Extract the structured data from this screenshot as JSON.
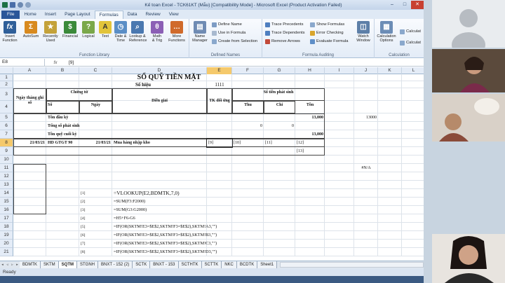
{
  "app": {
    "title": "Kế toan Excel - TCK61KT (Mẫu)  [Compatibility Mode]  -  Microsoft Excel (Product Activation Failed)",
    "win_min": "–",
    "win_max": "□",
    "win_close": "✕"
  },
  "tabs": [
    "File",
    "Home",
    "Insert",
    "Page Layout",
    "Formulas",
    "Data",
    "Review",
    "View"
  ],
  "ribbon": {
    "insert_function": "Insert\nFunction",
    "autosum": "AutoSum",
    "recently_used": "Recently\nUsed",
    "financial": "Financial",
    "logical": "Logical",
    "text": "Text",
    "date_time": "Date &\nTime",
    "lookup_reference": "Lookup &\nReference",
    "math_trig": "Math\n& Trig",
    "more_functions": "More\nFunctions",
    "group_function_library": "Function Library",
    "name_manager": "Name\nManager",
    "define_name": "Define Name",
    "use_in_formula": "Use in Formula",
    "create_from_selection": "Create from Selection",
    "group_defined_names": "Defined Names",
    "trace_precedents": "Trace Precedents",
    "trace_dependents": "Trace Dependents",
    "remove_arrows": "Remove Arrows",
    "show_formulas": "Show Formulas",
    "error_checking": "Error Checking",
    "evaluate_formula": "Evaluate Formula",
    "watch_window": "Watch\nWindow",
    "group_formula_auditing": "Formula Auditing",
    "calculation_options": "Calculation\nOptions",
    "calculate_now": "Calculat",
    "calculate_sheet": "Calculat",
    "group_calculation": "Calculation"
  },
  "formula_bar": {
    "name_box": "E8",
    "fx": "fx",
    "content": "[9]"
  },
  "columns": [
    "A",
    "B",
    "C",
    "D",
    "E",
    "F",
    "G",
    "H",
    "I",
    "J",
    "K",
    "L"
  ],
  "rows": [
    "1",
    "2",
    "3",
    "4",
    "5",
    "6",
    "7",
    "8",
    "9",
    "10",
    "11",
    "12",
    "13",
    "14",
    "15",
    "16",
    "17",
    "18",
    "19",
    "20",
    "21"
  ],
  "sheet": {
    "title": "SỔ QUỸ TIỀN MẶT",
    "so_hieu": "Số hiệu",
    "so_hieu_val": "1111",
    "ngay_thang_ghi_so": "Ngày tháng ghi sổ",
    "chung_tu": "Chứng từ",
    "so": "Số",
    "ngay": "Ngày",
    "dien_giai": "Diễn giải",
    "tk_doi_ung": "TK đối ứng",
    "so_tien_phat_sinh": "Số tiền phát sinh",
    "thu": "Thu",
    "chi": "Chi",
    "ton": "Tồn",
    "ton_dau_ky": "Tồn đầu kỳ",
    "ton_dau_ky_val": "13,000",
    "j5_val": "13000",
    "tong_so_phat_sinh": "Tổng số phát sinh",
    "f6_val": "0",
    "g6_val": "0",
    "ton_quy_cuoi_ky": "Tồn quỹ cuối kỳ",
    "h7_val": "13,000",
    "a8": "21/03/21",
    "b8": "HD GTGT 90",
    "c8": "21/03/21",
    "d8": "Mua hàng nhập kho",
    "e8": "[9]",
    "f8": "[10]",
    "g8": "[11]",
    "h8": "[12]",
    "h9": "[13]",
    "j11": "#N/A",
    "c14": "[1]",
    "d14": "=VLOOKUP(E2,BDMTK,7,0)",
    "c15": "[2]",
    "d15": "=SUM(F3:F2000)",
    "c16": "[3]",
    "d16": "=SUM(G3:G2000)",
    "c17": "[4]",
    "d17": "=H5+F6-G6",
    "c18": "[5]",
    "d18": "=IF(OR(SKTM!E3=$E$2,SKTM!F3=$E$2),SKTM!A3,\"\")",
    "c19": "[6]",
    "d19": "=IF(OR(SKTM!E3=$E$2,SKTM!F3=$E$2),SKTM!B3,\"\")",
    "c20": "[7]",
    "d20": "=IF(OR(SKTM!E3=$E$2,SKTM!F3=$E$2),SKTM!C3,\"\")",
    "c21": "[8]",
    "d21": "=IF(OR(SKTM!E3=$E$2,SKTM!F3=$E$2),SKTM!D3,\"\")"
  },
  "sheet_tabs": [
    "BDMTK",
    "SKTM",
    "SQTM",
    "STGNH",
    "BNXT - 152 (2)",
    "SCTK",
    "BNXT - 153",
    "SCTHTK",
    "SCTTK",
    "NKC",
    "BCDTK",
    "Sheet1"
  ],
  "active_sheet": "SQTM",
  "status": "Ready"
}
